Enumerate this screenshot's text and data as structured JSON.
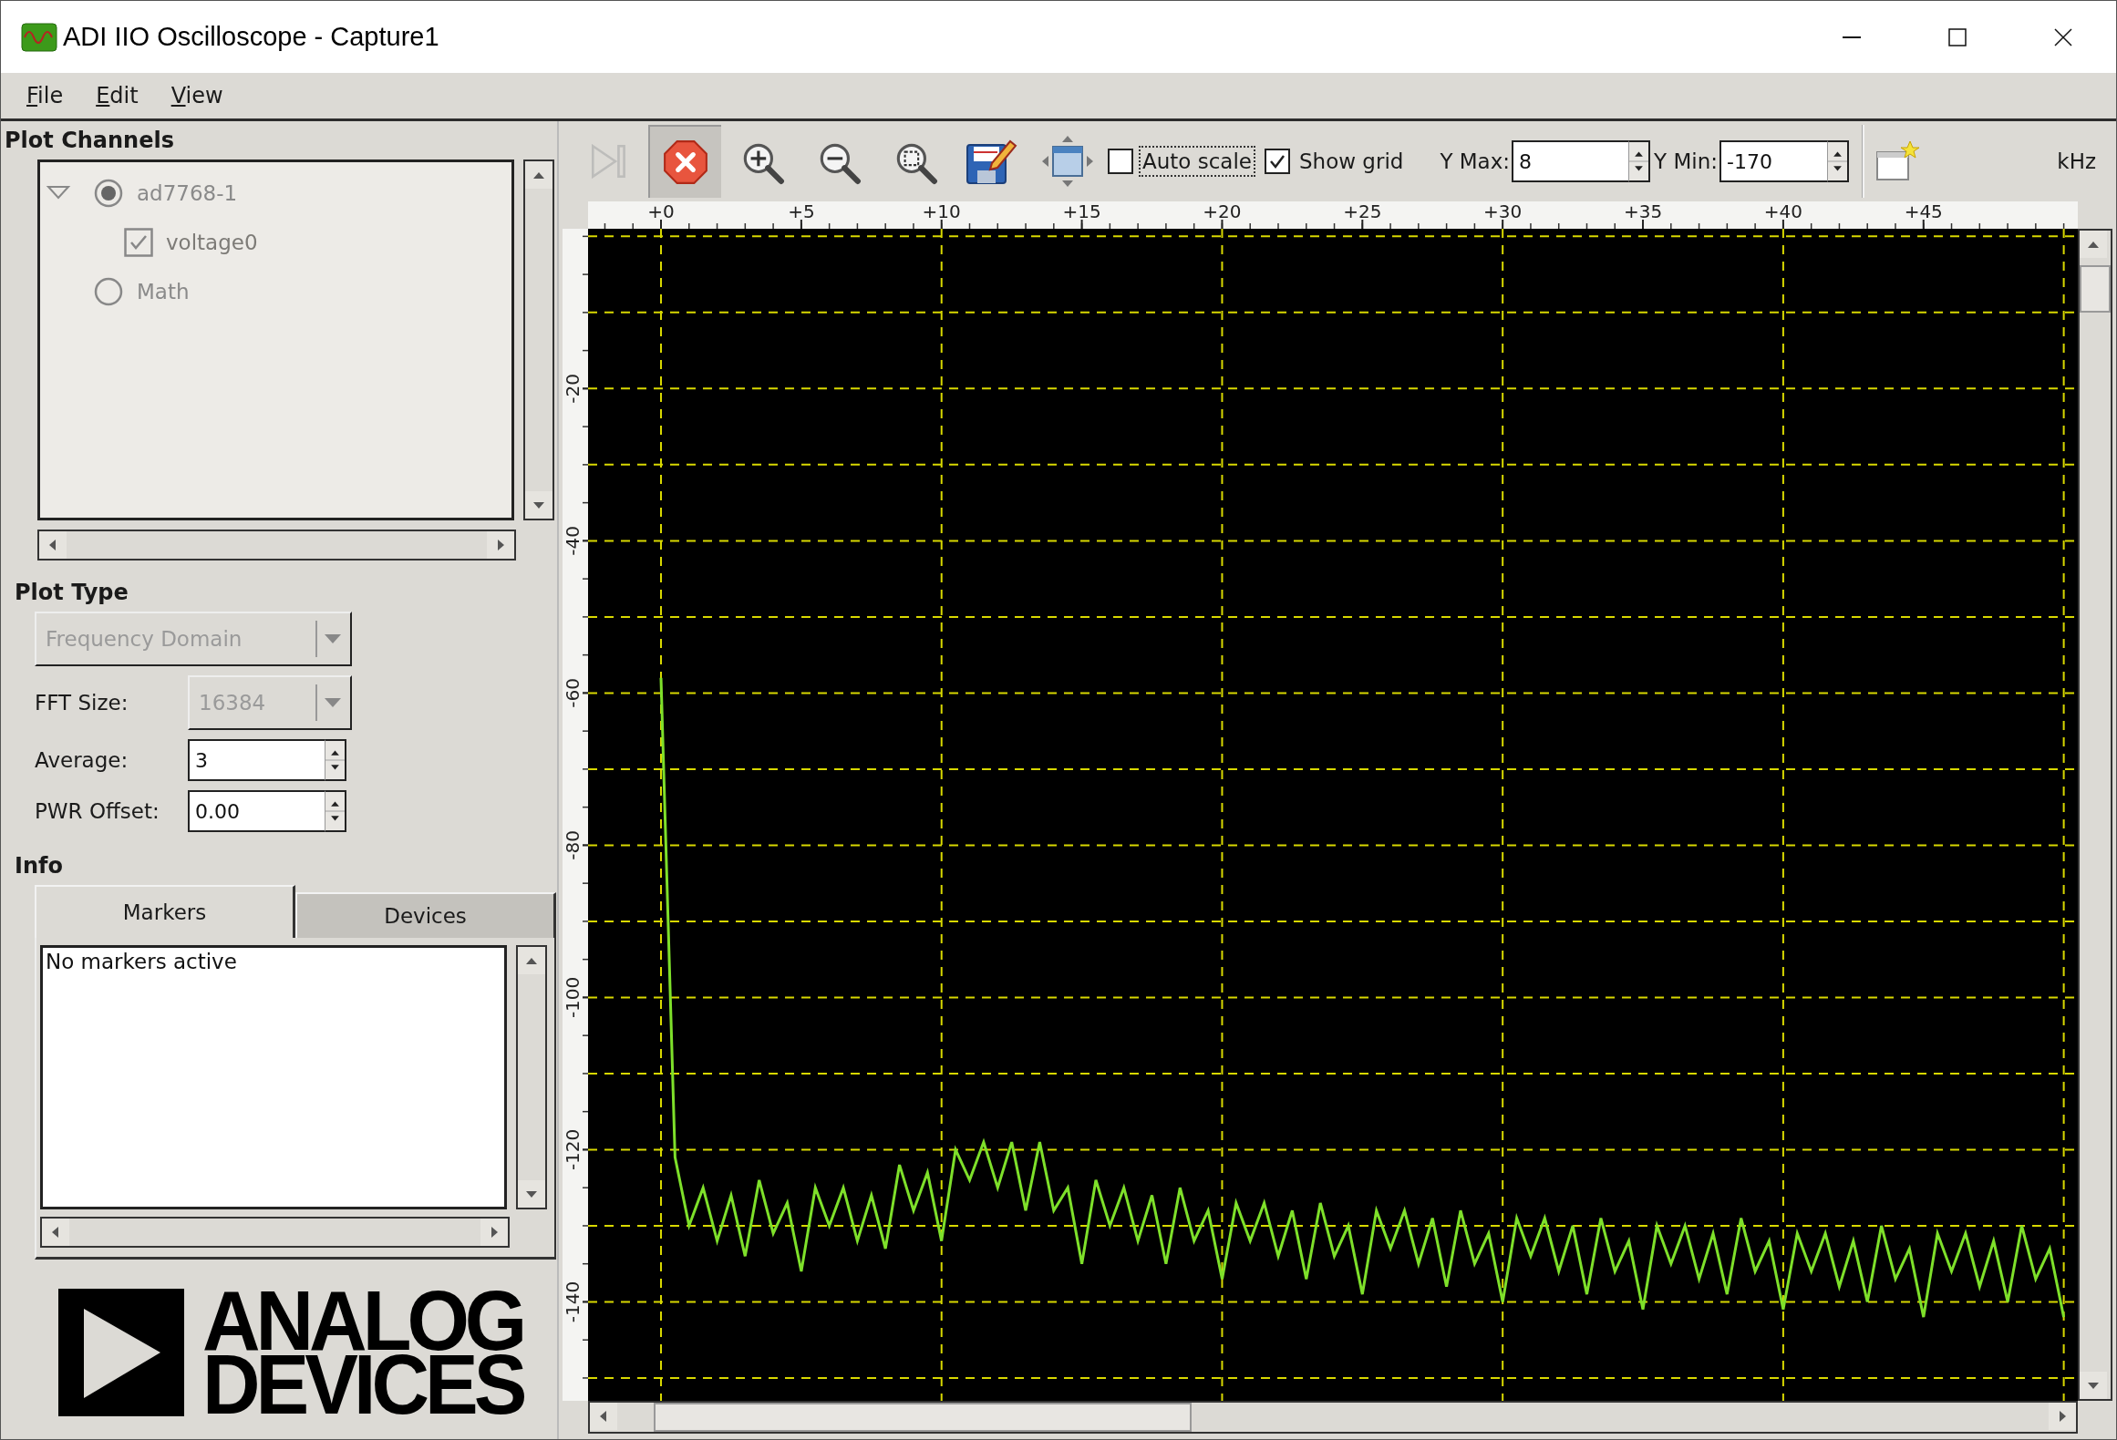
{
  "window": {
    "title": "ADI IIO Oscilloscope - Capture1"
  },
  "menu": [
    "File",
    "Edit",
    "View"
  ],
  "plot_channels": {
    "title": "Plot Channels",
    "items": [
      {
        "kind": "radio",
        "label": "ad7768-1",
        "selected": true,
        "expanded": true,
        "children": [
          {
            "kind": "checkbox",
            "label": "voltage0",
            "checked": true
          }
        ]
      },
      {
        "kind": "radio",
        "label": "Math",
        "selected": false
      }
    ]
  },
  "plot_type": {
    "title": "Plot Type",
    "value": "Frequency Domain",
    "disabled": true
  },
  "settings": [
    {
      "kind": "combo",
      "label": "FFT Size:",
      "value": "16384",
      "disabled": true
    },
    {
      "kind": "spin",
      "label": "Average:",
      "value": "3",
      "disabled": false
    },
    {
      "kind": "spin",
      "label": "PWR Offset:",
      "value": "0.00",
      "disabled": false
    }
  ],
  "info": {
    "title": "Info",
    "tabs": [
      {
        "label": "Markers",
        "selected": true
      },
      {
        "label": "Devices",
        "selected": false
      }
    ],
    "text": "No markers active"
  },
  "logo": {
    "lines": [
      "ANALOG",
      "DEVICES"
    ]
  },
  "toolbar": {
    "buttons": [
      {
        "kind": "step",
        "disabled": true,
        "pressed": false
      },
      {
        "kind": "stop",
        "disabled": false,
        "pressed": true
      },
      {
        "kind": "zoom-in",
        "disabled": false,
        "pressed": false
      },
      {
        "kind": "zoom-out",
        "disabled": false,
        "pressed": false
      },
      {
        "kind": "zoom-fit",
        "disabled": false,
        "pressed": false
      },
      {
        "kind": "save",
        "disabled": false,
        "pressed": false
      },
      {
        "kind": "fullscreen",
        "disabled": false,
        "pressed": false
      }
    ],
    "checkboxes": [
      {
        "label": "Auto scale",
        "checked": false,
        "focused": true
      },
      {
        "label": "Show grid",
        "checked": true,
        "focused": false
      }
    ],
    "spins": [
      {
        "label": "Y Max:",
        "value": "8"
      },
      {
        "label": "Y Min:",
        "value": "-170"
      }
    ],
    "unit": "kHz"
  },
  "plot": {
    "chart_data": {
      "type": "line",
      "grid": true,
      "xlim": [
        -2.6,
        50.5
      ],
      "ylim": [
        -153,
        1
      ],
      "xticks": [
        {
          "value": 0,
          "label": "+0"
        },
        {
          "value": 5,
          "label": "+5"
        },
        {
          "value": 10,
          "label": "+10"
        },
        {
          "value": 15,
          "label": "+15"
        },
        {
          "value": 20,
          "label": "+20"
        },
        {
          "value": 25,
          "label": "+25"
        },
        {
          "value": 30,
          "label": "+30"
        },
        {
          "value": 35,
          "label": "+35"
        },
        {
          "value": 40,
          "label": "+40"
        },
        {
          "value": 45,
          "label": "+45"
        }
      ],
      "yticks": [
        -20,
        -40,
        -60,
        -80,
        -100,
        -120,
        -140
      ],
      "x": [
        0,
        0.5,
        1,
        1.5,
        2,
        2.5,
        3,
        3.5,
        4,
        4.5,
        5,
        5.5,
        6,
        6.5,
        7,
        7.5,
        8,
        8.5,
        9,
        9.5,
        10,
        10.5,
        11,
        11.5,
        12,
        12.5,
        13,
        13.5,
        14,
        14.5,
        15,
        15.5,
        16,
        16.5,
        17,
        17.5,
        18,
        18.5,
        19,
        19.5,
        20,
        20.5,
        21,
        21.5,
        22,
        22.5,
        23,
        23.5,
        24,
        24.5,
        25,
        25.5,
        26,
        26.5,
        27,
        27.5,
        28,
        28.5,
        29,
        29.5,
        30,
        30.5,
        31,
        31.5,
        32,
        32.5,
        33,
        33.5,
        34,
        34.5,
        35,
        35.5,
        36,
        36.5,
        37,
        37.5,
        38,
        38.5,
        39,
        39.5,
        40,
        40.5,
        41,
        41.5,
        42,
        42.5,
        43,
        43.5,
        44,
        44.5,
        45,
        45.5,
        46,
        46.5,
        47,
        47.5,
        48,
        48.5,
        49,
        49.5,
        50
      ],
      "series": [
        {
          "color": "#7ee02a",
          "values": [
            -58,
            -121,
            -130,
            -125,
            -132,
            -126,
            -134,
            -124,
            -131,
            -127,
            -136,
            -125,
            -130,
            -125,
            -132,
            -126,
            -133,
            -122,
            -128,
            -123,
            -132,
            -120,
            -124,
            -119,
            -125,
            -119,
            -128,
            -119,
            -128,
            -125,
            -135,
            -124,
            -130,
            -125,
            -132,
            -126,
            -135,
            -125,
            -132,
            -128,
            -137,
            -127,
            -132,
            -127,
            -134,
            -128,
            -137,
            -127,
            -134,
            -130,
            -139,
            -128,
            -133,
            -128,
            -135,
            -129,
            -138,
            -128,
            -135,
            -131,
            -140,
            -129,
            -134,
            -129,
            -136,
            -130,
            -139,
            -129,
            -136,
            -132,
            -141,
            -130,
            -135,
            -130,
            -137,
            -131,
            -139,
            -129,
            -136,
            -132,
            -141,
            -131,
            -136,
            -131,
            -138,
            -132,
            -140,
            -130,
            -137,
            -133,
            -142,
            -131,
            -136,
            -131,
            -138,
            -132,
            -140,
            -130,
            -137,
            -133,
            -142
          ]
        }
      ]
    }
  }
}
